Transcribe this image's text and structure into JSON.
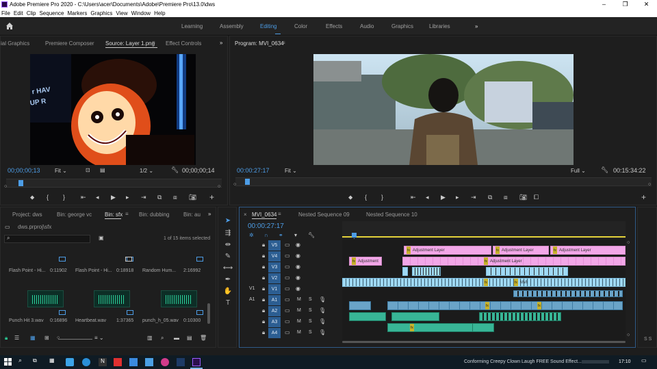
{
  "window": {
    "title": "Adobe Premiere Pro 2020 - C:\\Users\\acer\\Documents\\Adobe\\Premiere Pro\\13.0\\dws",
    "min": "–",
    "max": "❐",
    "close": "✕"
  },
  "menu": [
    "File",
    "Edit",
    "Clip",
    "Sequence",
    "Markers",
    "Graphics",
    "View",
    "Window",
    "Help"
  ],
  "workspaces": [
    "Learning",
    "Assembly",
    "Editing",
    "Color",
    "Effects",
    "Audio",
    "Graphics",
    "Libraries"
  ],
  "workspace_active": "Editing",
  "source_tabs": [
    "ial Graphics",
    "Premiere Composer",
    "Source: Layer 1.png",
    "Effect Controls"
  ],
  "source": {
    "timecode_in": "00;00;00;13",
    "fit": "Fit",
    "ratio": "1/2",
    "timecode_out": "00;00;00;14"
  },
  "program": {
    "tab": "Program: MVI_0634",
    "timecode_in": "00:00:27:17",
    "fit": "Fit",
    "quality": "Full",
    "timecode_out": "00:15:34:22"
  },
  "project_tabs": [
    "Project: dws",
    "Bin: george vc",
    "Bin: sfx",
    "Bin: dubbing",
    "Bin: au"
  ],
  "project": {
    "path": "dws.prproj\\sfx",
    "count": "1 of 15 items selected"
  },
  "bin_items": [
    {
      "name": "Flash Point - Hi...",
      "dur": "0:11902"
    },
    {
      "name": "Flash Point - Hi...",
      "dur": "0:18918"
    },
    {
      "name": "Random Hum...",
      "dur": "2:16992"
    },
    {
      "name": "Punch Hit 3.wav",
      "dur": "0:16896"
    },
    {
      "name": "Heartbeat.wav",
      "dur": "1:37365"
    },
    {
      "name": "punch_h_05.wav",
      "dur": "0:10300"
    }
  ],
  "timeline_tabs": [
    "MVI_0634",
    "Nested Sequence 09",
    "Nested Sequence 10"
  ],
  "timeline": {
    "timecode": "00:00:27:17"
  },
  "video_tracks": [
    "V5",
    "V4",
    "V3",
    "V2",
    "V1"
  ],
  "audio_tracks": [
    "A1",
    "A2",
    "A3",
    "A4"
  ],
  "track_m": "M",
  "track_s": "S",
  "src_patch": {
    "v": "V1",
    "a": "A1"
  },
  "clips": {
    "adjustment": "Adjustment Layer",
    "adjust_short": "Adjustment",
    "mvi": "MVI",
    "fx": "fx"
  },
  "status": "Conforming Creepy Clown Laugh FREE Sound Effect...",
  "clock": "17:10",
  "meter_solo": "S S",
  "colors": {
    "accent": "#4d9de6",
    "pink_clip": "#f2a7e8",
    "cyan_clip": "#9fd9f5",
    "audio_clip": "#38b596"
  }
}
